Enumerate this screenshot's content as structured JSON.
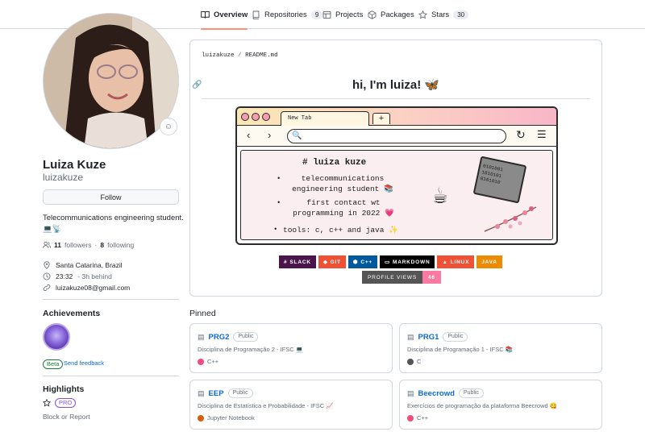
{
  "nav": {
    "tabs": [
      {
        "label": "Overview",
        "icon": "book-icon",
        "active": true
      },
      {
        "label": "Repositories",
        "icon": "repo-icon",
        "count": "9"
      },
      {
        "label": "Projects",
        "icon": "table-icon"
      },
      {
        "label": "Packages",
        "icon": "package-icon"
      },
      {
        "label": "Stars",
        "icon": "star-icon",
        "count": "30"
      }
    ]
  },
  "profile": {
    "name": "Luiza Kuze",
    "login": "luizakuze",
    "follow_label": "Follow",
    "bio": "Telecommunications engineering student. 💻📡",
    "followers_count": "11",
    "followers_label": "followers",
    "following_count": "8",
    "following_label": "following",
    "location": "Santa Catarina, Brazil",
    "time": "23:32",
    "time_note": "- 3h behind",
    "email": "luizakuze08@gmail.com",
    "status_emoji": "☺"
  },
  "achievements": {
    "title": "Achievements",
    "beta_label": "Beta",
    "feedback_label": "Send feedback"
  },
  "highlights": {
    "title": "Highlights",
    "pro_label": "PRO",
    "block_label": "Block or Report"
  },
  "readme": {
    "crumb_user": "luizakuze",
    "crumb_sep": "/",
    "crumb_file": "README.md",
    "heading": "hi, I'm luiza! 🦋",
    "browser": {
      "tab_title": "New Tab",
      "content_title": "# luiza kuze",
      "item1": "telecommunications\nengineering student 📚",
      "item2": "first contact wt\nprogramming in 2022 💗",
      "item3": "tools: c, c++ and java ✨",
      "folder_text": "0101001\n1010101\n0101010"
    },
    "badges": [
      {
        "label": "SLACK",
        "color": "#4a154b"
      },
      {
        "label": "GIT",
        "color": "#f05033"
      },
      {
        "label": "C++",
        "color": "#00599c"
      },
      {
        "label": "MARKDOWN",
        "color": "#000000"
      },
      {
        "label": "LINUX",
        "color": "#fcc624",
        "text_color": "#000000"
      },
      {
        "label": "JAVA",
        "color": "#ed8b00"
      }
    ],
    "views_label": "PROFILE VIEWS",
    "views_count": "46"
  },
  "pinned": {
    "title": "Pinned",
    "repos": [
      {
        "name": "PRG2",
        "visibility": "Public",
        "description": "Disciplina de Programação 2 - IFSC 💻",
        "language": "C++",
        "lang_color": "#f34b7d"
      },
      {
        "name": "PRG1",
        "visibility": "Public",
        "description": "Disciplina de Programação 1 - IFSC 📚",
        "language": "C",
        "lang_color": "#555555"
      },
      {
        "name": "EEP",
        "visibility": "Public",
        "description": "Disciplina de Estatística e Probabilidade - IFSC 📈",
        "language": "Jupyter Notebook",
        "lang_color": "#da5b0b"
      },
      {
        "name": "Beecrowd",
        "visibility": "Public",
        "description": "Exercícios de programação da plataforma Beecrowd 😋",
        "language": "C++",
        "lang_color": "#f34b7d"
      }
    ]
  }
}
